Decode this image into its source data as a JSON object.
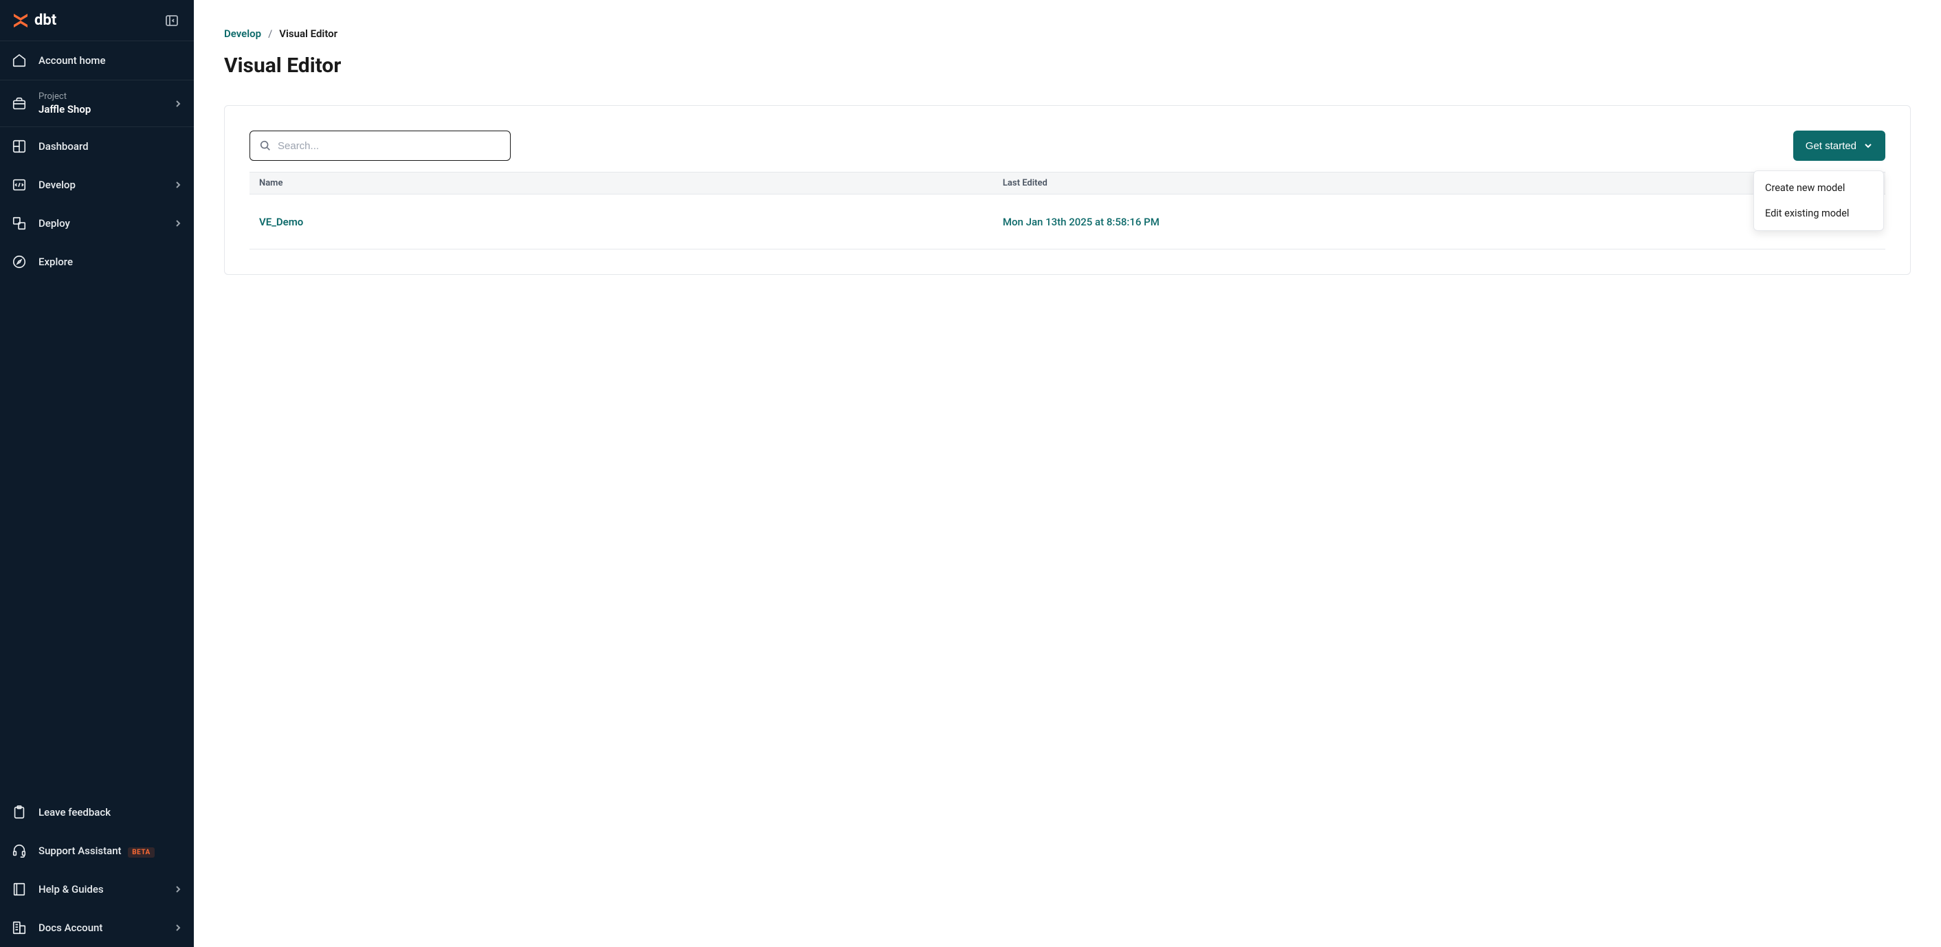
{
  "logo": {
    "text": "dbt"
  },
  "sidebar": {
    "account_home": "Account home",
    "project_label": "Project",
    "project_name": "Jaffle Shop",
    "nav": {
      "dashboard": "Dashboard",
      "develop": "Develop",
      "deploy": "Deploy",
      "explore": "Explore"
    },
    "footer": {
      "feedback": "Leave feedback",
      "support": "Support Assistant",
      "support_badge": "BETA",
      "help": "Help & Guides",
      "docs": "Docs Account"
    }
  },
  "breadcrumb": {
    "develop": "Develop",
    "separator": "/",
    "current": "Visual Editor"
  },
  "page_title": "Visual Editor",
  "search": {
    "placeholder": "Search..."
  },
  "get_started_button": "Get started",
  "dropdown": {
    "create": "Create new model",
    "edit": "Edit existing model"
  },
  "table": {
    "headers": {
      "name": "Name",
      "last_edited": "Last Edited"
    },
    "rows": [
      {
        "name": "VE_Demo",
        "last_edited": "Mon Jan 13th 2025 at 8:58:16 PM"
      }
    ]
  }
}
